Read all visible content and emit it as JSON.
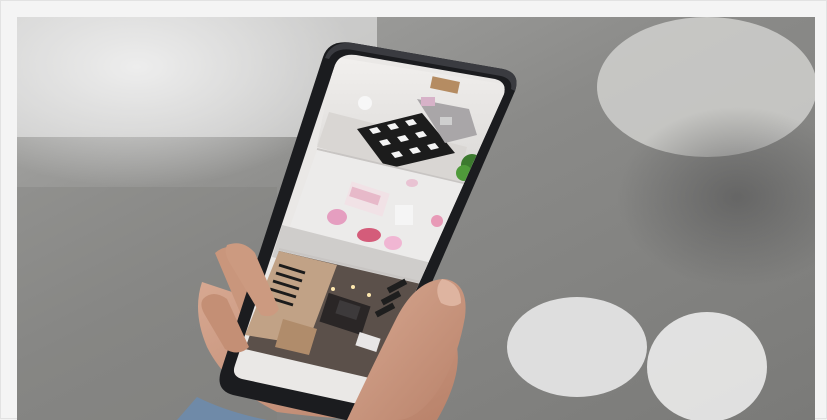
{
  "image": {
    "subject": "hand-holding-smartphone-with-home-security-camera-feeds",
    "panels": [
      "living-room-camera",
      "kids-bedroom-camera",
      "home-office-camera"
    ]
  },
  "colors": {
    "frame": "#f4f4f4",
    "phone_body": "#1b1c1f",
    "background_gray": "#8e8e8e",
    "skin": "#c9967c"
  }
}
